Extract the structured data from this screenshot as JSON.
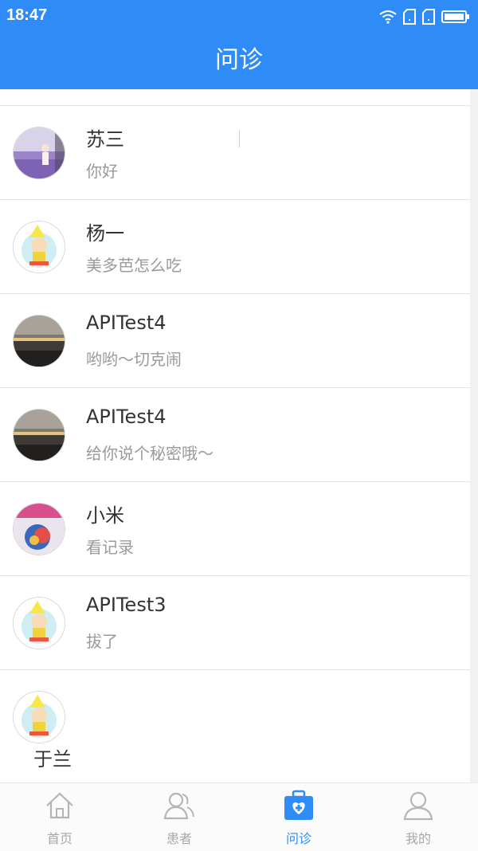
{
  "status_bar": {
    "time": "18:47"
  },
  "header": {
    "title": "问诊"
  },
  "conversations": [
    {
      "name": "苏三",
      "message": "你好",
      "avatar": "lavender-field-photo"
    },
    {
      "name": "杨一",
      "message": "美多芭怎么吃",
      "avatar": "cartoon-child-default"
    },
    {
      "name": "APITest4",
      "message": "哟哟～切克闹",
      "avatar": "sunset-photo"
    },
    {
      "name": "APITest4",
      "message": "给你说个秘密哦～",
      "avatar": "sunset-photo"
    },
    {
      "name": "小米",
      "message": "看记录",
      "avatar": "colorful-sculpture-photo"
    },
    {
      "name": "APITest3",
      "message": "拔了",
      "avatar": "cartoon-child-default"
    },
    {
      "name": "于兰",
      "message": "",
      "avatar": "cartoon-child-default"
    }
  ],
  "tabs": [
    {
      "label": "首页",
      "icon": "home-icon",
      "active": false
    },
    {
      "label": "患者",
      "icon": "patients-icon",
      "active": false
    },
    {
      "label": "问诊",
      "icon": "medical-kit-icon",
      "active": true
    },
    {
      "label": "我的",
      "icon": "profile-icon",
      "active": false
    }
  ],
  "colors": {
    "primary": "#2f8cf6",
    "inactive": "#a8a8a8",
    "divider": "#e3e3e3"
  }
}
